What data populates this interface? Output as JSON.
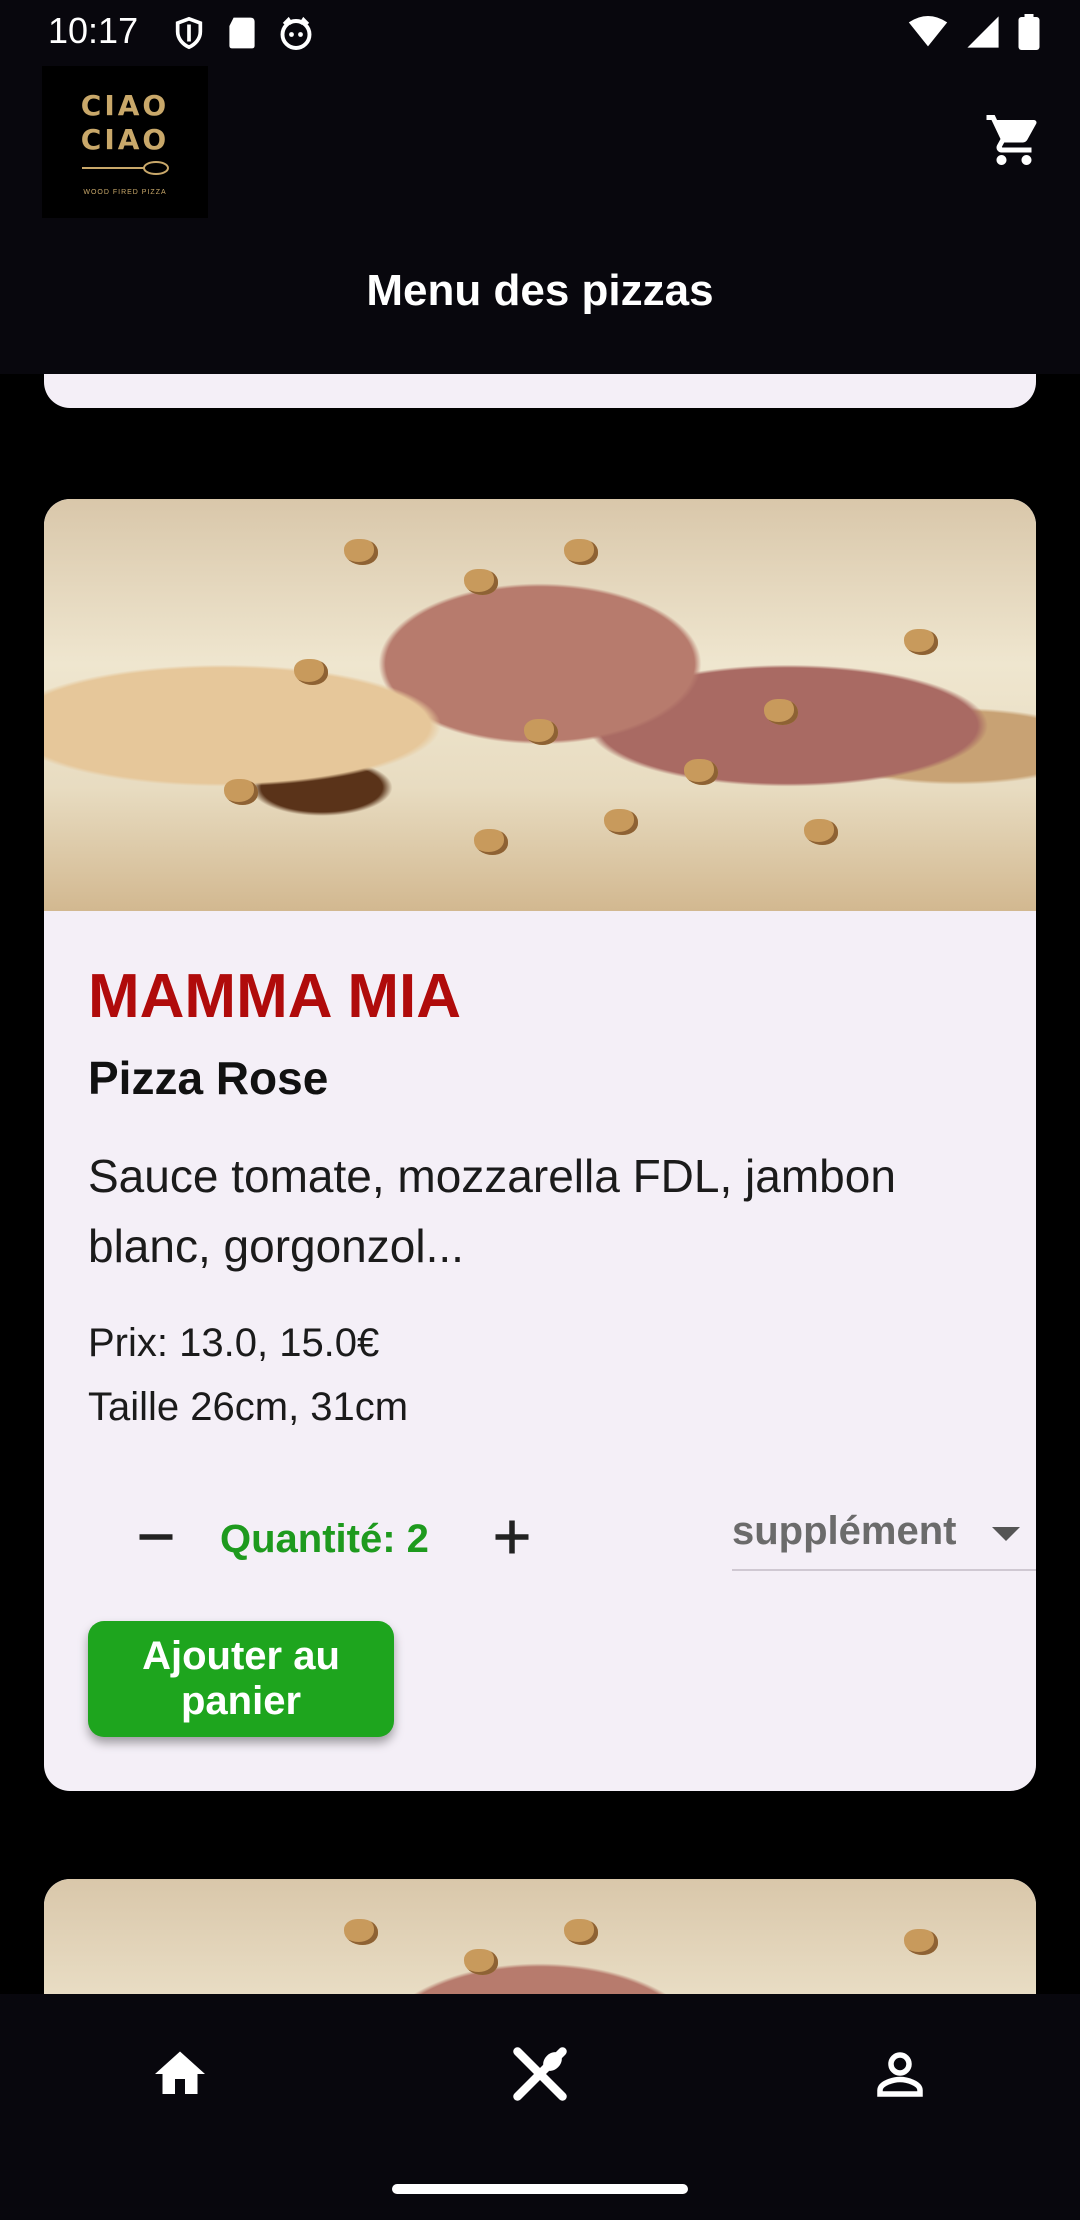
{
  "status_bar": {
    "time": "10:17",
    "left_icons": [
      "shield-icon",
      "sd-card-icon",
      "cat-icon"
    ],
    "right_icons": [
      "wifi-icon",
      "signal-icon",
      "battery-icon"
    ]
  },
  "header": {
    "logo": {
      "line1": "CIAO",
      "line2": "CIAO",
      "tagline": "WOOD FIRED PIZZA"
    },
    "cart_icon": "cart-icon",
    "title": "Menu des pizzas"
  },
  "pizza": {
    "name": "MAMMA MIA",
    "type": "Pizza Rose",
    "description": "Sauce tomate, mozzarella FDL, jambon blanc, gorgonzol...",
    "price": "Prix: 13.0, 15.0€",
    "size": "Taille 26cm, 31cm",
    "quantity_label": "Quantité: 2",
    "supplement_placeholder": "supplément",
    "add_button": "Ajouter au panier"
  },
  "colors": {
    "pizza_name": "#b00b0b",
    "quantity": "#1e9a1e",
    "add_button": "#1ea51e",
    "card_bg": "#f4eff7",
    "bars": "#08070d"
  },
  "bottom_nav": {
    "items": [
      "home-icon",
      "restaurant-icon",
      "person-icon"
    ]
  }
}
